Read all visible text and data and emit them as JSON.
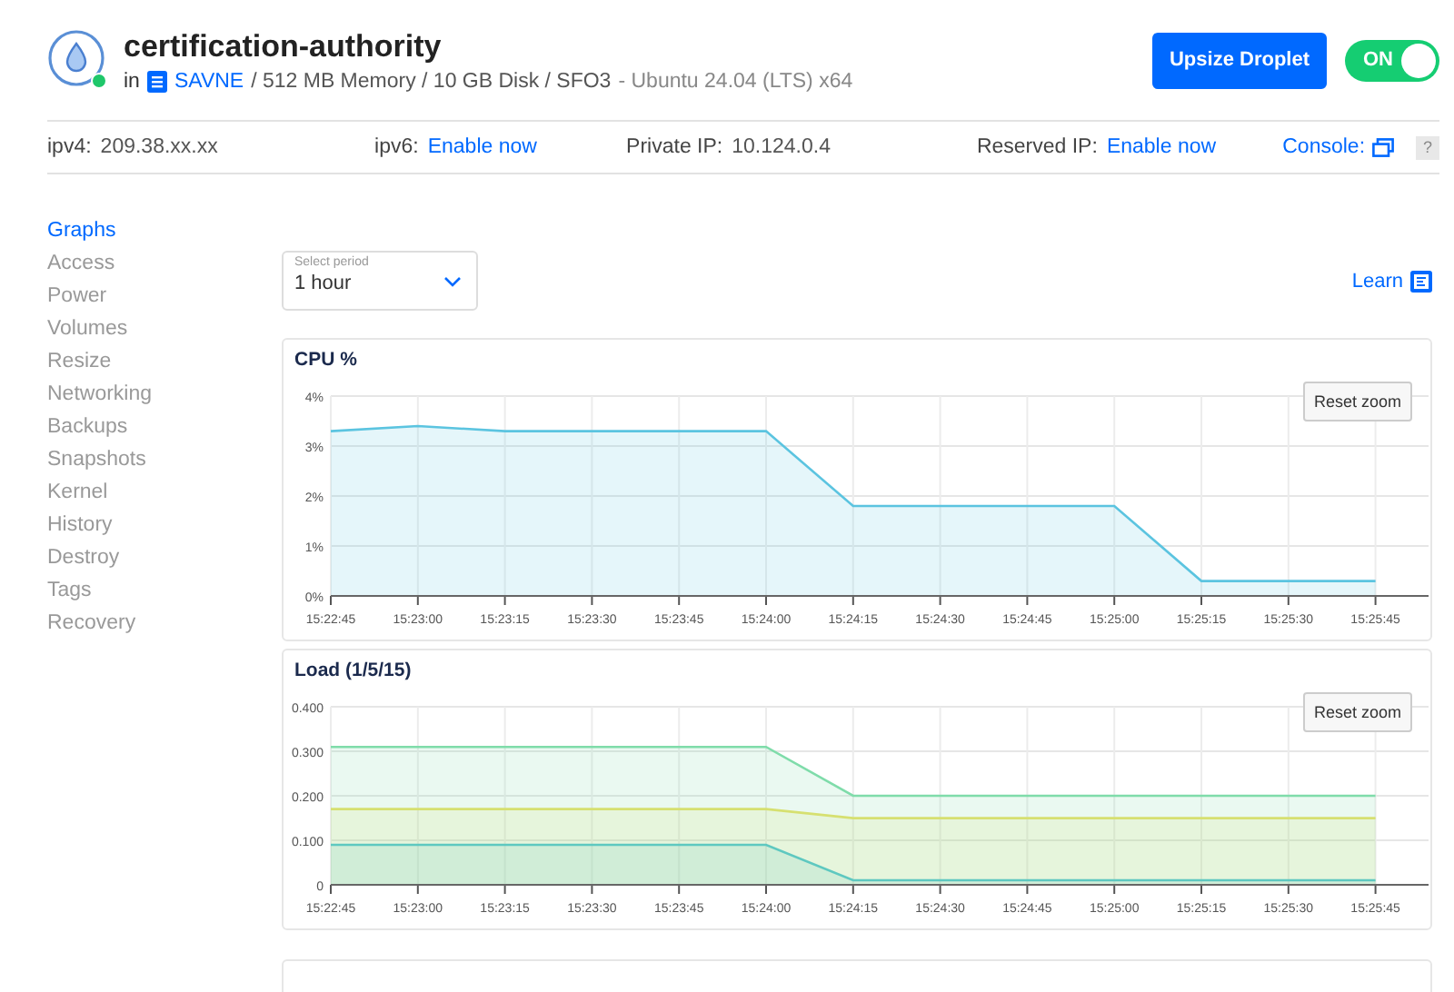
{
  "header": {
    "title": "certification-authority",
    "online": true,
    "in_label": "in",
    "project": "SAVNE",
    "specs": "/ 512 MB Memory / 10 GB Disk / SFO3",
    "os": "- Ubuntu 24.04 (LTS) x64",
    "upsize_button": "Upsize Droplet",
    "power": {
      "label": "ON",
      "on": true
    }
  },
  "info_bar": [
    {
      "label": "ipv4:",
      "value": "209.38.xx.xx",
      "kind": "text"
    },
    {
      "label": "ipv6:",
      "value": "Enable now",
      "kind": "link"
    },
    {
      "label": "Private IP:",
      "value": "10.124.0.4",
      "kind": "text"
    },
    {
      "label": "Reserved IP:",
      "value": "Enable now",
      "kind": "link"
    }
  ],
  "console": {
    "label": "Console:",
    "help": "?"
  },
  "sidebar": {
    "items": [
      {
        "label": "Graphs",
        "selected": true
      },
      {
        "label": "Access",
        "selected": false
      },
      {
        "label": "Power",
        "selected": false
      },
      {
        "label": "Volumes",
        "selected": false
      },
      {
        "label": "Resize",
        "selected": false
      },
      {
        "label": "Networking",
        "selected": false
      },
      {
        "label": "Backups",
        "selected": false
      },
      {
        "label": "Snapshots",
        "selected": false
      },
      {
        "label": "Kernel",
        "selected": false
      },
      {
        "label": "History",
        "selected": false
      },
      {
        "label": "Destroy",
        "selected": false
      },
      {
        "label": "Tags",
        "selected": false
      },
      {
        "label": "Recovery",
        "selected": false
      }
    ]
  },
  "period": {
    "placeholder": "Select period",
    "value": "1 hour"
  },
  "learn": "Learn",
  "charts": [
    {
      "reset_button": "Reset zoom",
      "chart_data": {
        "type": "area",
        "grid": true,
        "title": "CPU %",
        "x": [
          "15:22:45",
          "15:23:00",
          "15:23:15",
          "15:23:30",
          "15:23:45",
          "15:24:00",
          "15:24:15",
          "15:24:30",
          "15:24:45",
          "15:25:00",
          "15:25:15",
          "15:25:30",
          "15:25:45"
        ],
        "ylim": [
          0,
          4
        ],
        "yticks": [
          {
            "value": 0,
            "label": "0%"
          },
          {
            "value": 1,
            "label": "1%"
          },
          {
            "value": 2,
            "label": "2%"
          },
          {
            "value": 3,
            "label": "3%"
          },
          {
            "value": 4,
            "label": "4%"
          }
        ],
        "series": [
          {
            "color": "#5bc4e0",
            "values": [
              3.3,
              3.4,
              3.3,
              3.3,
              3.3,
              3.3,
              1.8,
              1.8,
              1.8,
              1.8,
              0.3,
              0.3,
              0.3
            ]
          }
        ]
      }
    },
    {
      "reset_button": "Reset zoom",
      "chart_data": {
        "type": "area",
        "grid": true,
        "title": "Load (1/5/15)",
        "x": [
          "15:22:45",
          "15:23:00",
          "15:23:15",
          "15:23:30",
          "15:23:45",
          "15:24:00",
          "15:24:15",
          "15:24:30",
          "15:24:45",
          "15:25:00",
          "15:25:15",
          "15:25:30",
          "15:25:45"
        ],
        "ylim": [
          0,
          0.4
        ],
        "yticks": [
          {
            "value": 0,
            "label": "0"
          },
          {
            "value": 0.1,
            "label": "0.100"
          },
          {
            "value": 0.2,
            "label": "0.200"
          },
          {
            "value": 0.3,
            "label": "0.300"
          },
          {
            "value": 0.4,
            "label": "0.400"
          }
        ],
        "series": [
          {
            "color": "#7fdcaa",
            "values": [
              0.31,
              0.31,
              0.31,
              0.31,
              0.31,
              0.31,
              0.2,
              0.2,
              0.2,
              0.2,
              0.2,
              0.2,
              0.2
            ]
          },
          {
            "color": "#d6e070",
            "values": [
              0.17,
              0.17,
              0.17,
              0.17,
              0.17,
              0.17,
              0.15,
              0.15,
              0.15,
              0.15,
              0.15,
              0.15,
              0.15
            ]
          },
          {
            "color": "#5ec8c0",
            "values": [
              0.09,
              0.09,
              0.09,
              0.09,
              0.09,
              0.09,
              0.01,
              0.01,
              0.01,
              0.01,
              0.01,
              0.01,
              0.01
            ]
          }
        ]
      }
    }
  ]
}
